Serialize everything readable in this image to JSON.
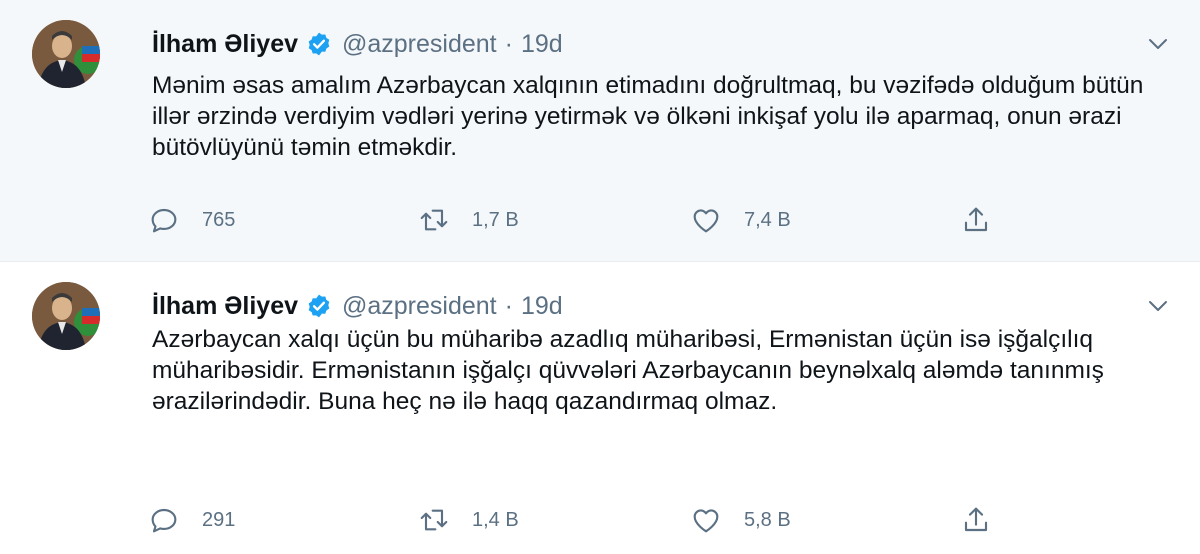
{
  "colors": {
    "text": "#0f1419",
    "muted": "#5b7083",
    "verified": "#1da1f2",
    "highlight_bg": "#f5f8fa"
  },
  "tweets": [
    {
      "author_name": "İlham Əliyev",
      "handle": "@azpresident",
      "separator": "·",
      "time": "19d",
      "text": "Mənim əsas amalım Azərbaycan xalqının etimadını doğrultmaq, bu vəzifədə olduğum bütün illər ərzində verdiyim vədləri yerinə yetirmək və ölkəni inkişaf yolu ilə aparmaq, onun ərazi bütövlüyünü təmin etməkdir.",
      "replies": "765",
      "retweets": "1,7 B",
      "likes": "7,4 B"
    },
    {
      "author_name": "İlham Əliyev",
      "handle": "@azpresident",
      "separator": "·",
      "time": "19d",
      "text": "Azərbaycan xalqı üçün bu müharibə azadlıq müharibəsi, Ermənistan üçün isə işğalçılıq müharibəsidir. Ermənistanın işğalçı qüvvələri Azərbaycanın beynəlxalq aləmdə tanınmış ərazilərindədir. Buna heç nə ilə haqq qazandırmaq olmaz.",
      "replies": "291",
      "retweets": "1,4 B",
      "likes": "5,8 B"
    }
  ]
}
